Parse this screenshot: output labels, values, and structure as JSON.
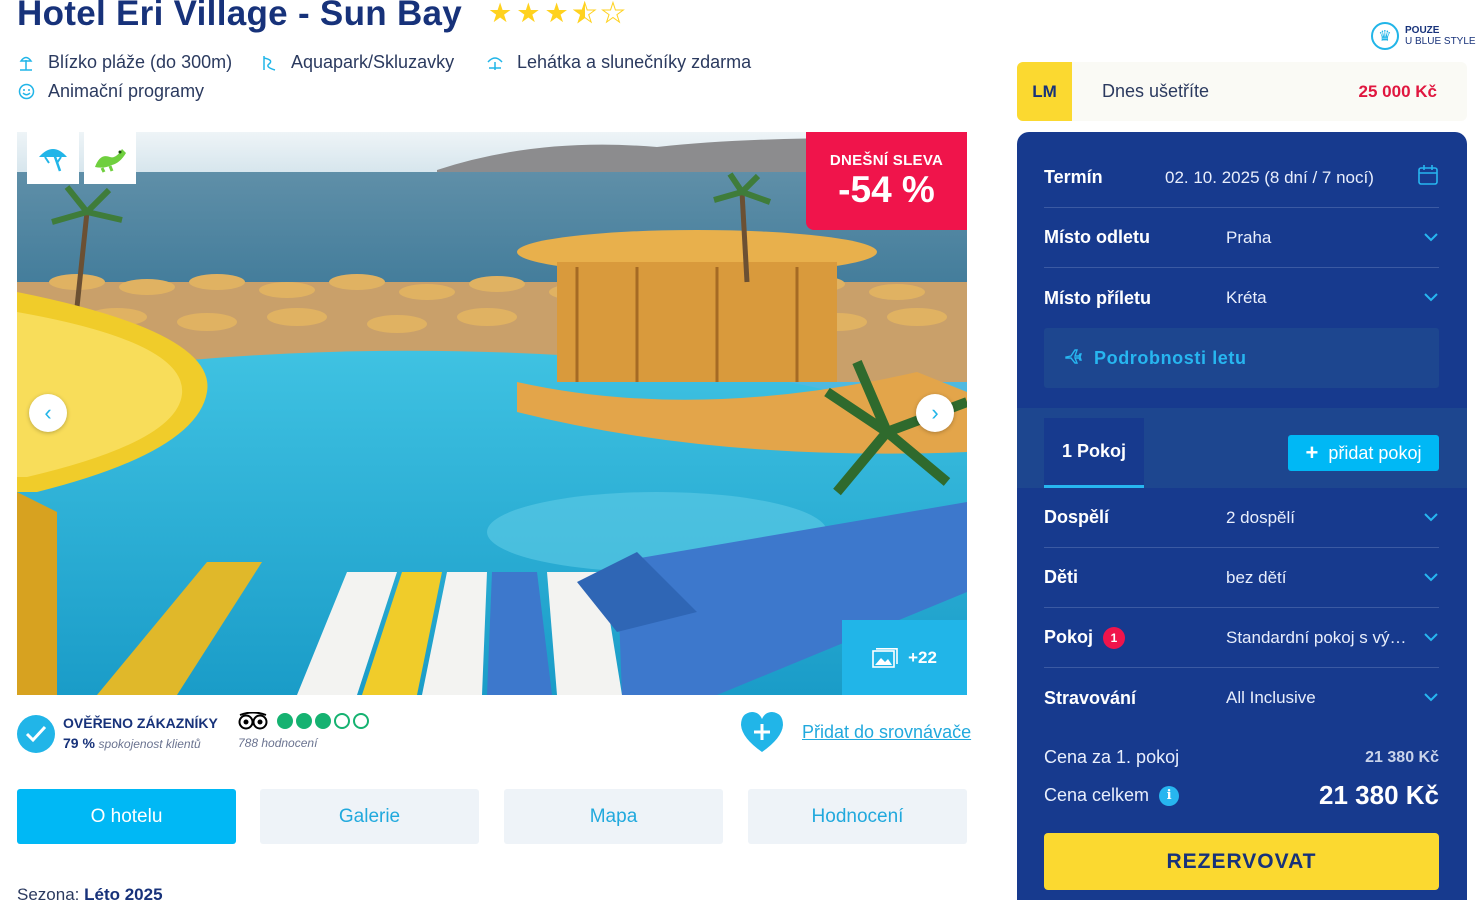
{
  "hotel": {
    "name": "Hotel Eri Village - Sun Bay",
    "stars": 3.5,
    "features": [
      {
        "icon": "beach-icon",
        "label": "Blízko pláže (do 300m)"
      },
      {
        "icon": "waterslide-icon",
        "label": "Aquapark/Skluzavky"
      },
      {
        "icon": "sunbed-icon",
        "label": "Lehátka a slunečníky zdarma"
      },
      {
        "icon": "smile-icon",
        "label": "Animační programy"
      }
    ]
  },
  "gallery": {
    "sale_label": "DNEŠNÍ SLEVA",
    "sale_value": "-54 %",
    "more_photos": "+22"
  },
  "reviews": {
    "verified_title": "OVĚŘENO ZÁKAZNÍKY",
    "satisfaction_value": "79 %",
    "satisfaction_text": "spokojenost klientů",
    "tripadvisor_rating": 3,
    "tripadvisor_max": 5,
    "tripadvisor_count": "788 hodnocení"
  },
  "compare_link": "Přidat do srovnávače",
  "tabs": [
    "O hotelu",
    "Galerie",
    "Mapa",
    "Hodnocení"
  ],
  "season": {
    "label": "Sezona:",
    "value": "Léto 2025"
  },
  "blue_style": {
    "line1": "POUZE",
    "line2": "U BLUE STYLE"
  },
  "lastminute": {
    "tag": "LM",
    "text": "Dnes ušetříte",
    "saving": "25 000 Kč"
  },
  "booking": {
    "term_label": "Termín",
    "term_value": "02. 10. 2025 (8 dní / 7 nocí)",
    "departure_label": "Místo odletu",
    "departure_value": "Praha",
    "arrival_label": "Místo příletu",
    "arrival_value": "Kréta",
    "flight_details": "Podrobnosti letu",
    "room_tab": "1 Pokoj",
    "add_room": "přidat pokoj",
    "adults_label": "Dospělí",
    "adults_value": "2 dospělí",
    "children_label": "Děti",
    "children_value": "bez dětí",
    "room_label": "Pokoj",
    "room_badge": "1",
    "room_value": "Standardní pokoj s výhledem",
    "board_label": "Stravování",
    "board_value": "All Inclusive",
    "price_room_label": "Cena za 1. pokoj",
    "price_room_value": "21 380 Kč",
    "price_total_label": "Cena celkem",
    "price_total_value": "21 380 Kč",
    "reserve_button": "REZERVOVAT"
  },
  "colors": {
    "primary_navy": "#173a8e",
    "accent_cyan": "#00b8f5",
    "sale_red": "#f0144b",
    "cta_yellow": "#fbd930",
    "tripadvisor_green": "#15b271"
  }
}
